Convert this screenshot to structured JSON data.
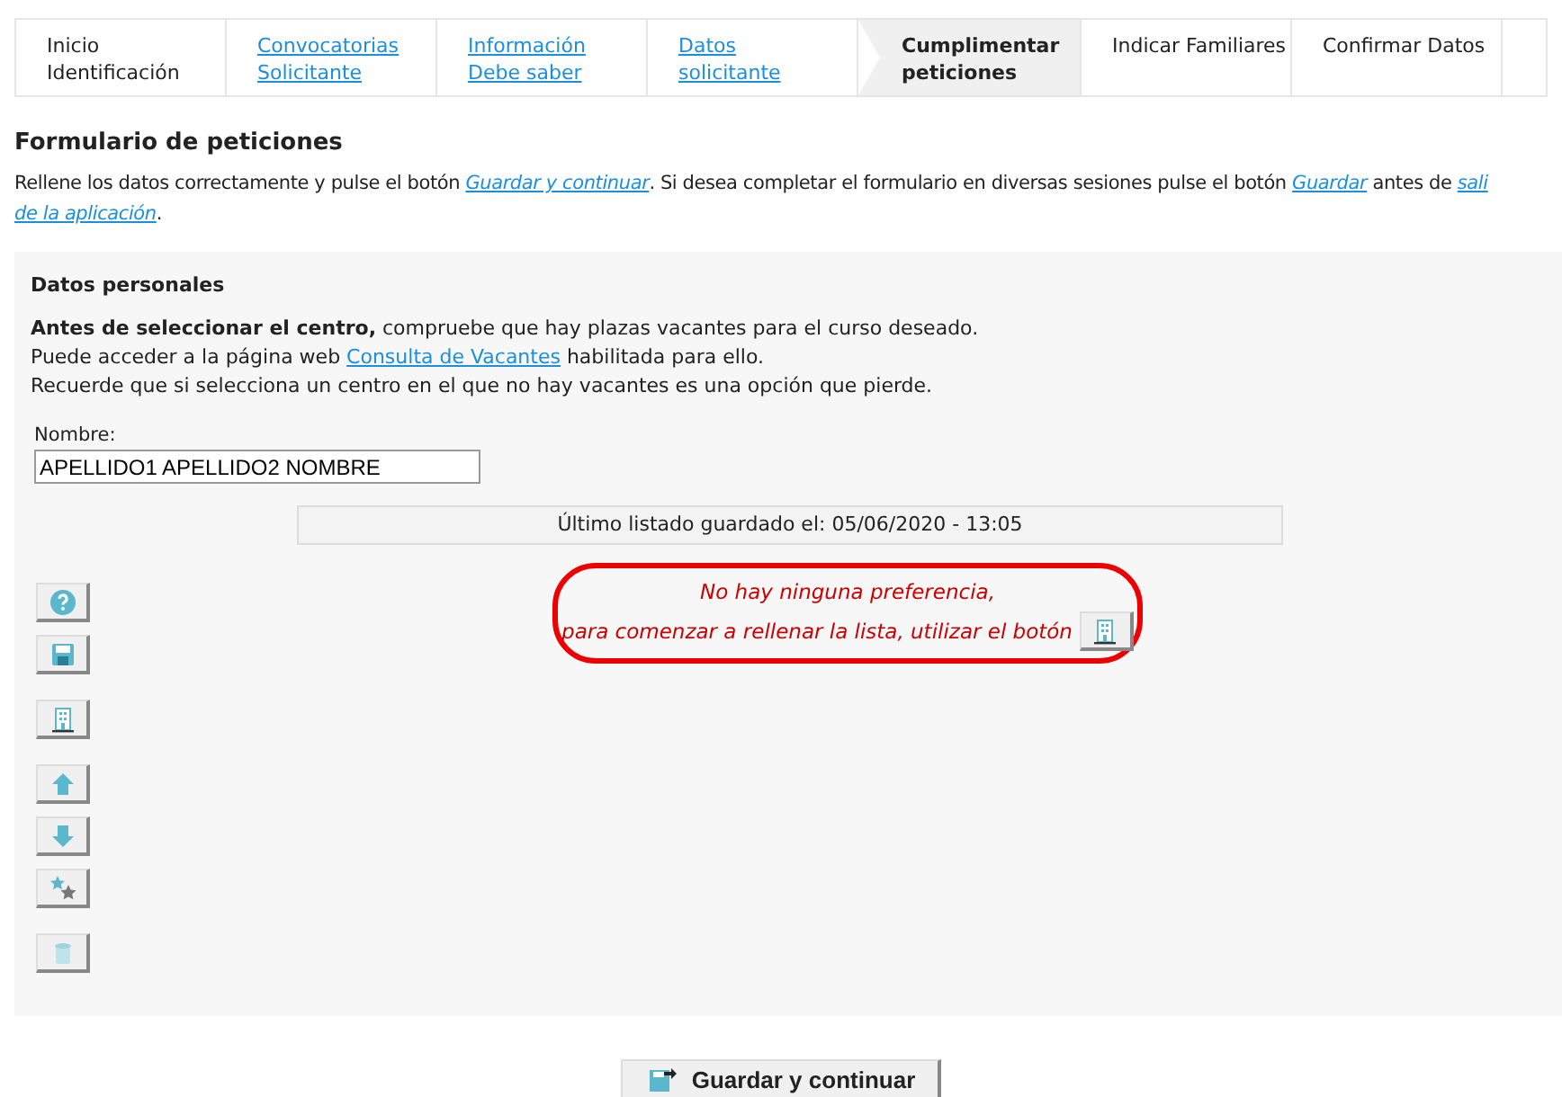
{
  "steps": [
    {
      "lines": [
        "Inicio",
        "Identificación"
      ],
      "link": false,
      "selected": false
    },
    {
      "lines": [
        "Convocatorias",
        "Solicitante"
      ],
      "link": true,
      "selected": false
    },
    {
      "lines": [
        "Información",
        "Debe saber"
      ],
      "link": true,
      "selected": false
    },
    {
      "lines": [
        "Datos",
        "solicitante"
      ],
      "link": true,
      "selected": false
    },
    {
      "lines": [
        "Cumplimentar",
        "peticiones"
      ],
      "link": false,
      "selected": true
    },
    {
      "lines": [
        "Indicar Familiares"
      ],
      "link": false,
      "selected": false
    },
    {
      "lines": [
        "Confirmar Datos"
      ],
      "link": false,
      "selected": false
    }
  ],
  "title": "Formulario de peticiones",
  "intro": [
    [
      {
        "text": "Rellene los datos correctamente y pulse el botón ",
        "link": false
      },
      {
        "text": "Guardar y continuar",
        "link": true
      },
      {
        "text": ". Si desea completar el formulario en diversas sesiones pulse el botón ",
        "link": false
      },
      {
        "text": "Guardar",
        "link": true
      },
      {
        "text": " antes de ",
        "link": false
      },
      {
        "text": "sali",
        "link": true
      }
    ],
    [
      {
        "text": "de la aplicación",
        "link": true
      },
      {
        "text": ".",
        "link": false
      }
    ]
  ],
  "panel": {
    "heading": "Datos personales",
    "notice": [
      {
        "bold": "Antes de seleccionar el centro,",
        "text": " compruebe que hay plazas vacantes para el curso deseado."
      },
      {
        "text": "Puede acceder a la página web ",
        "link": "Consulta de Vacantes",
        "after": " habilitada para ello."
      },
      {
        "text": "Recuerde que si selecciona un centro en el que no hay vacantes es una opción que pierde."
      }
    ],
    "name_label": "Nombre:",
    "name_value": "APELLIDO1 APELLIDO2 NOMBRE",
    "last_saved": "Último listado guardado el: 05/06/2020 - 13:05",
    "empty_message": [
      "No hay ninguna preferencia,",
      "para comenzar a rellenar la lista, utilizar el botón"
    ],
    "tools": [
      {
        "kind": "help"
      },
      {
        "kind": "save"
      },
      {
        "kind": "building"
      },
      {
        "kind": "up"
      },
      {
        "kind": "down"
      },
      {
        "kind": "star"
      },
      {
        "kind": "trash"
      }
    ]
  },
  "submit": "Guardar y continuar"
}
